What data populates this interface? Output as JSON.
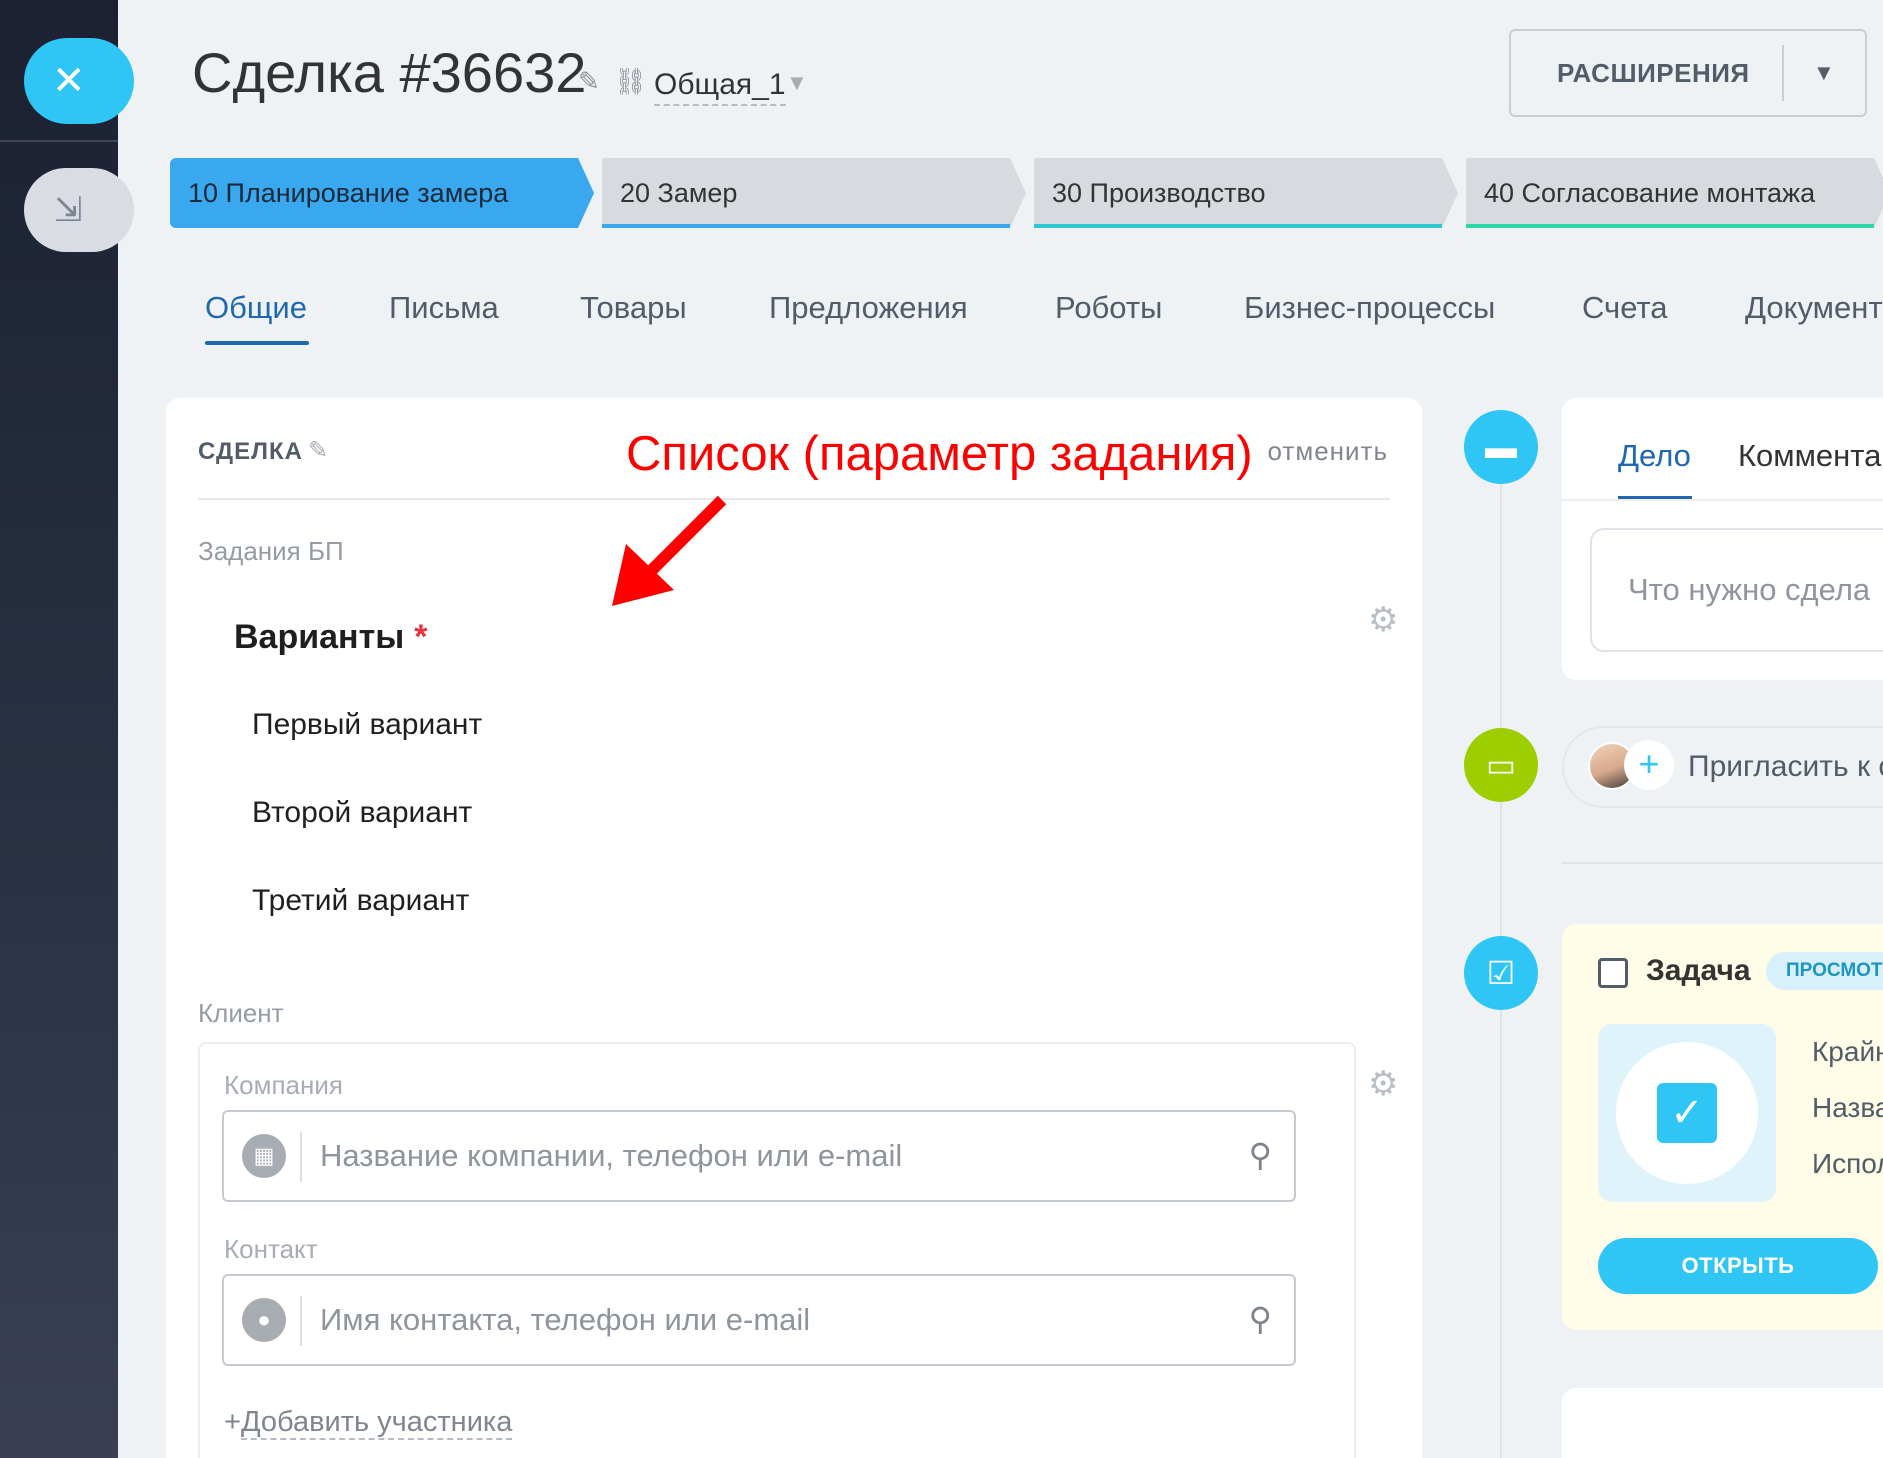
{
  "header": {
    "deal_title": "Сделка #36632",
    "category": "Общая_1",
    "extensions_label": "РАСШИРЕНИЯ"
  },
  "stages": [
    {
      "label": "10 Планирование замера",
      "status": "active",
      "color": "#39a8ef"
    },
    {
      "label": "20 Замер",
      "status": "inactive",
      "color": "#39a8ef"
    },
    {
      "label": "30 Производство",
      "status": "inactive",
      "color": "#2fc6d6"
    },
    {
      "label": "40 Согласование монтажа",
      "status": "inactive",
      "color": "#2fd6a8"
    }
  ],
  "tabs": [
    "Общие",
    "Письма",
    "Товары",
    "Предложения",
    "Роботы",
    "Бизнес-процессы",
    "Счета",
    "Документ"
  ],
  "card": {
    "title": "СДЕЛКА",
    "cancel": "отменить",
    "annotation": "Список (параметр задания)",
    "bp_tasks_label": "Задания БП",
    "variants_title": "Варианты",
    "required_mark": "*",
    "variants": [
      "Первый вариант",
      "Второй вариант",
      "Третий вариант"
    ],
    "client_label": "Клиент",
    "company_label": "Компания",
    "company_placeholder": "Название компании, телефон или e-mail",
    "contact_label": "Контакт",
    "contact_placeholder": "Имя контакта, телефон или e-mail",
    "add_member_plus": "+",
    "add_member": "Добавить участника"
  },
  "timeline": {
    "editor_tabs": [
      "Дело",
      "Комментар"
    ],
    "editor_placeholder": "Что нужно сдела",
    "invite_text": "Пригласить к о",
    "task_title": "Задача",
    "task_badge": "ПРОСМОТ",
    "task_meta": [
      "Крайн",
      "Назва",
      "Испол"
    ],
    "task_open": "ОТКРЫТЬ"
  },
  "colors": {
    "accent": "#2fc6f6",
    "link": "#2067b0",
    "annotation": "#ff0000",
    "stage_active": "#39a8ef",
    "dot_comment": "#2fc6f6",
    "dot_chat": "#9dcf00",
    "dot_task": "#2fc6f6"
  },
  "icons": [
    "close-icon",
    "collapse-icon",
    "pencil-icon",
    "link-icon",
    "caret-down-icon",
    "gear-icon",
    "building-icon",
    "person-icon",
    "search-icon",
    "comment-icon",
    "chat-icon",
    "task-icon",
    "checkbox-icon",
    "plus-icon"
  ]
}
